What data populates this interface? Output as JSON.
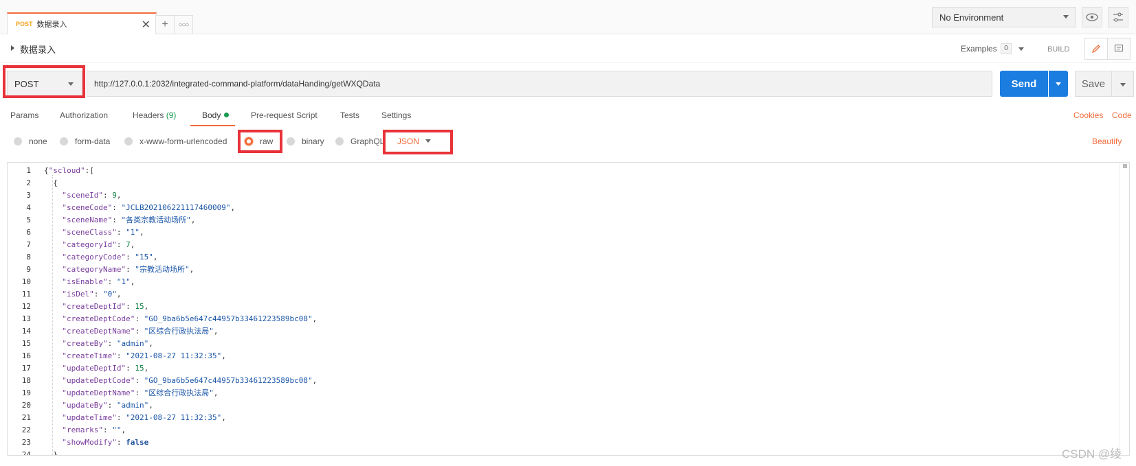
{
  "tab": {
    "method": "POST",
    "name": "数据录入"
  },
  "environment": {
    "selected": "No Environment"
  },
  "request": {
    "name": "数据录入",
    "method": "POST",
    "url": "http://127.0.0.1:2032/integrated-command-platform/dataHanding/getWXQData"
  },
  "toolbar": {
    "examples_label": "Examples",
    "examples_count": "0",
    "build_label": "BUILD",
    "send_label": "Send",
    "save_label": "Save"
  },
  "request_tabs": {
    "params": "Params",
    "authorization": "Authorization",
    "headers": "Headers",
    "headers_count": "(9)",
    "body": "Body",
    "prerequest": "Pre-request Script",
    "tests": "Tests",
    "settings": "Settings",
    "cookies": "Cookies",
    "code": "Code"
  },
  "body_types": {
    "none": "none",
    "form_data": "form-data",
    "urlencoded": "x-www-form-urlencoded",
    "raw": "raw",
    "binary": "binary",
    "graphql": "GraphQL",
    "format": "JSON",
    "beautify": "Beautify",
    "selected": "raw"
  },
  "editor": {
    "line_numbers": [
      "1",
      "2",
      "3",
      "4",
      "5",
      "6",
      "7",
      "8",
      "9",
      "10",
      "11",
      "12",
      "13",
      "14",
      "15",
      "16",
      "17",
      "18",
      "19",
      "20",
      "21",
      "22",
      "23",
      "24"
    ],
    "fields": [
      {
        "key": "\"sceneId\"",
        "value": "9",
        "type": "number"
      },
      {
        "key": "\"sceneCode\"",
        "value": "\"JCLB202106221117460009\"",
        "type": "string"
      },
      {
        "key": "\"sceneName\"",
        "value": "\"各类宗教活动场所\"",
        "type": "string"
      },
      {
        "key": "\"sceneClass\"",
        "value": "\"1\"",
        "type": "string"
      },
      {
        "key": "\"categoryId\"",
        "value": "7",
        "type": "number"
      },
      {
        "key": "\"categoryCode\"",
        "value": "\"15\"",
        "type": "string"
      },
      {
        "key": "\"categoryName\"",
        "value": "\"宗教活动场所\"",
        "type": "string"
      },
      {
        "key": "\"isEnable\"",
        "value": "\"1\"",
        "type": "string"
      },
      {
        "key": "\"isDel\"",
        "value": "\"0\"",
        "type": "string"
      },
      {
        "key": "\"createDeptId\"",
        "value": "15",
        "type": "number"
      },
      {
        "key": "\"createDeptCode\"",
        "value": "\"GO_9ba6b5e647c44957b33461223589bc08\"",
        "type": "string"
      },
      {
        "key": "\"createDeptName\"",
        "value": "\"区综合行政执法局\"",
        "type": "string"
      },
      {
        "key": "\"createBy\"",
        "value": "\"admin\"",
        "type": "string"
      },
      {
        "key": "\"createTime\"",
        "value": "\"2021-08-27 11:32:35\"",
        "type": "string"
      },
      {
        "key": "\"updateDeptId\"",
        "value": "15",
        "type": "number"
      },
      {
        "key": "\"updateDeptCode\"",
        "value": "\"GO_9ba6b5e647c44957b33461223589bc08\"",
        "type": "string"
      },
      {
        "key": "\"updateDeptName\"",
        "value": "\"区综合行政执法局\"",
        "type": "string"
      },
      {
        "key": "\"updateBy\"",
        "value": "\"admin\"",
        "type": "string"
      },
      {
        "key": "\"updateTime\"",
        "value": "\"2021-08-27 11:32:35\"",
        "type": "string"
      },
      {
        "key": "\"remarks\"",
        "value": "\"\"",
        "type": "string"
      },
      {
        "key": "\"showModify\"",
        "value": "false",
        "type": "bool"
      }
    ],
    "root_key": "\"scloud\""
  },
  "watermark": "CSDN @绫",
  "colors": {
    "accent": "#f26b3a",
    "send": "#1b7de0",
    "highlight": "#e8323a",
    "string": "#1a55a8",
    "number": "#0b7f3e",
    "key": "#7a3e9d"
  },
  "icons": [
    "close-icon",
    "plus-icon",
    "more-icon",
    "eye-icon",
    "sliders-icon",
    "edit-icon",
    "comment-icon",
    "chevron-down-icon"
  ]
}
